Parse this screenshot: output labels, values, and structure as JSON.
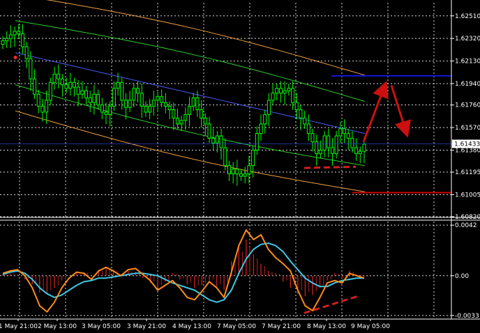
{
  "chart_data": [
    {
      "type": "candlestick",
      "panel": "price",
      "timeframe_label": "",
      "y_ticks": [
        "1.62510",
        "1.62320",
        "1.62130",
        "1.61940",
        "1.61760",
        "1.61570",
        "1.61380",
        "1.61195",
        "1.61005",
        "1.60820"
      ],
      "ylim": [
        1.6082,
        1.6262
      ],
      "current_price": "1.61433",
      "grid": true,
      "channel": {
        "center_line_color": "#4a5cff",
        "inner_band_color": "#2ecc2e",
        "outer_band_color": "#f0a040",
        "center_start": 1.622,
        "center_end": 1.6152,
        "inner_offset": 0.0027,
        "outer_offset": 0.0049
      },
      "levels": [
        {
          "name": "resistance",
          "value": 1.62005,
          "color": "#1414d8"
        },
        {
          "name": "support",
          "value": 1.61022,
          "color": "#d40000"
        }
      ],
      "closes": [
        1.623,
        1.6232,
        1.6235,
        1.6238,
        1.6236,
        1.6225,
        1.6215,
        1.6198,
        1.6185,
        1.6175,
        1.617,
        1.618,
        1.6195,
        1.6202,
        1.6198,
        1.6193,
        1.619,
        1.6195,
        1.6191,
        1.6185,
        1.6188,
        1.6182,
        1.6178,
        1.6185,
        1.6176,
        1.617,
        1.6168,
        1.6175,
        1.619,
        1.6195,
        1.618,
        1.6174,
        1.618,
        1.619,
        1.6186,
        1.6175,
        1.617,
        1.6175,
        1.618,
        1.6183,
        1.6178,
        1.6175,
        1.6172,
        1.6165,
        1.616,
        1.6163,
        1.6168,
        1.6175,
        1.6182,
        1.6172,
        1.6165,
        1.616,
        1.6148,
        1.6144,
        1.615,
        1.614,
        1.6125,
        1.6118,
        1.6122,
        1.6118,
        1.6116,
        1.6118,
        1.6125,
        1.6138,
        1.6152,
        1.616,
        1.6168,
        1.618,
        1.6186,
        1.619,
        1.6186,
        1.6188,
        1.619,
        1.6178,
        1.6172,
        1.6165,
        1.616,
        1.6152,
        1.6145,
        1.6135,
        1.6138,
        1.615,
        1.614,
        1.6135,
        1.615,
        1.6156,
        1.6152,
        1.6148,
        1.614,
        1.6135,
        1.6137,
        1.6143
      ]
    },
    {
      "type": "macd",
      "panel": "oscillator",
      "y_ticks": [
        "0.0042",
        "0.00",
        "-0.0033"
      ],
      "ylim": [
        -0.0036,
        0.0045
      ],
      "main_color": "#3fc9e6",
      "signal_color": "#ff8c1a",
      "histogram_color": "#c02020",
      "main": [
        0.0001,
        0.0003,
        0.0004,
        0.0002,
        -0.0003,
        -0.001,
        -0.0015,
        -0.0018,
        -0.0016,
        -0.0012,
        -0.0008,
        -0.0005,
        -0.0004,
        -0.0002,
        -0.0002,
        -0.0001,
        0.0,
        0.0001,
        0.0002,
        0.0002,
        0.0001,
        0.0,
        -0.0003,
        -0.0006,
        -0.0008,
        -0.001,
        -0.0012,
        -0.0016,
        -0.002,
        -0.0022,
        -0.002,
        -0.0012,
        0.0002,
        0.0014,
        0.0022,
        0.0026,
        0.0027,
        0.0025,
        0.002,
        0.0012,
        0.0005,
        -0.0002,
        -0.0006,
        -0.0009,
        -0.0009,
        -0.0006,
        -0.0004,
        -0.0003,
        -0.0002,
        -0.0002
      ],
      "signal": [
        0.0002,
        0.0004,
        0.0005,
        0.0,
        -0.001,
        -0.0025,
        -0.003,
        -0.0022,
        -0.001,
        -0.0002,
        0.0003,
        0.0002,
        -0.0003,
        0.0004,
        0.0007,
        0.0004,
        0.0,
        0.0005,
        0.0006,
        0.0001,
        -0.0004,
        -0.0012,
        -0.0008,
        -0.0004,
        -0.001,
        -0.0018,
        -0.002,
        -0.0013,
        -0.0005,
        -0.001,
        -0.0018,
        0.0003,
        0.0025,
        0.0038,
        0.003,
        0.0034,
        0.0022,
        0.0015,
        0.001,
        0.0004,
        -0.0012,
        -0.0025,
        -0.0029,
        -0.0018,
        -0.0006,
        -0.0004,
        -0.0006,
        0.0002,
        0.0,
        -0.0002
      ],
      "histogram": [
        0.0001,
        0.0002,
        0.0001,
        -0.0003,
        -0.0007,
        -0.0014,
        -0.0015,
        -0.001,
        -0.0004,
        0.0,
        0.0002,
        0.0003,
        0.0,
        0.0005,
        0.0007,
        0.0005,
        0.0001,
        0.0004,
        0.0003,
        -0.0002,
        -0.0006,
        -0.001,
        -0.0005,
        0.0002,
        -0.0003,
        -0.0007,
        -0.001,
        -0.0008,
        -0.0004,
        -0.0009,
        -0.0012,
        0.0012,
        0.0025,
        0.003,
        0.0018,
        0.001,
        0.0004,
        0.0002,
        -0.0005,
        -0.001,
        -0.0015,
        -0.0017,
        -0.0016,
        -0.001,
        -0.0004,
        0.0002,
        -0.0002,
        0.0004,
        0.0001,
        -0.0001
      ]
    }
  ],
  "x_ticks": [
    "1 May 21:00",
    "2 May 13:00",
    "3 May 05:00",
    "3 May 21:00",
    "4 May 13:00",
    "7 May 05:00",
    "7 May 21:00",
    "8 May 13:00",
    "9 May 05:00"
  ],
  "annotations": {
    "divergence_line_color": "#d02020",
    "forecast_arrow_color": "#cc1010",
    "price_divergence": [
      1.6123,
      1.6124
    ],
    "macd_divergence": [
      -0.0031,
      -0.0017
    ],
    "forecast_path": [
      1.6145,
      1.6195,
      1.615
    ]
  },
  "colors": {
    "background": "#000000",
    "grid": "#ffffff",
    "candle": "#00ff00",
    "text": "#ffffff",
    "marker": "#ff2a2a"
  }
}
